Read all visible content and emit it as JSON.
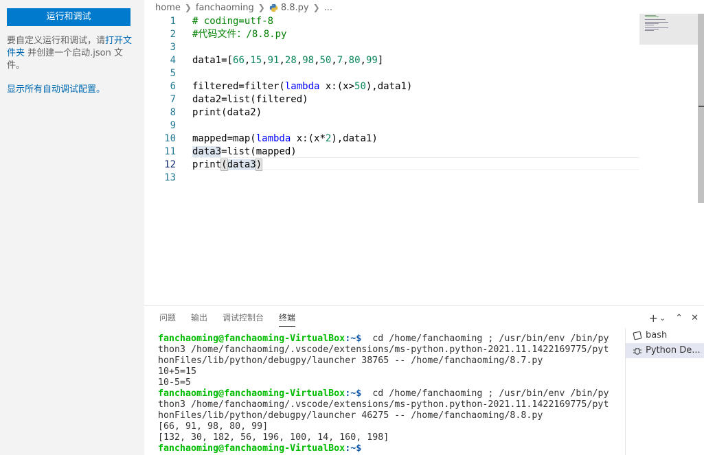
{
  "sidebar": {
    "run_button": "运行和调试",
    "text_pre": "要自定义运行和调试，请",
    "open_folder": "打开文件夹",
    "text_post": " 并创建一个启动.json 文件。",
    "show_all": "显示所有自动调试配置。"
  },
  "breadcrumb": [
    "home",
    "fanchaoming",
    "8.8.py",
    "..."
  ],
  "editor": {
    "line_numbers": [
      "1",
      "2",
      "3",
      "4",
      "5",
      "6",
      "7",
      "8",
      "9",
      "10",
      "11",
      "12",
      "13"
    ],
    "active_line": "12",
    "lines": {
      "l1": "# coding=utf-8",
      "l2": "#代码文件：/8.8.py",
      "l4_a": "data1=[",
      "l4_n": [
        "66",
        "15",
        "91",
        "28",
        "98",
        "50",
        "7",
        "80",
        "99"
      ],
      "l4_b": "]",
      "l6_a": "filtered=filter(",
      "l6_kw": "lambda",
      "l6_b": " x:(x>",
      "l6_n": "50",
      "l6_c": "),data1)",
      "l7": "data2=list(filtered)",
      "l8": "print(data2)",
      "l10_a": "mapped=map(",
      "l10_kw": "lambda",
      "l10_b": " x:(x*",
      "l10_n": "2",
      "l10_c": "),data1)",
      "l11_a": "data3",
      "l11_b": "=list(mapped)",
      "l12_a": "print",
      "l12_b": "(",
      "l12_c": "data3",
      "l12_d": ")"
    }
  },
  "panel": {
    "tabs": [
      "问题",
      "输出",
      "调试控制台",
      "终端"
    ],
    "active_tab": "终端",
    "actions": [
      "+",
      "⌄",
      "⌃",
      "✕"
    ],
    "terminal_lines": [
      {
        "user": "fanchaoming@fanchaoming-VirtualBox",
        "path": ":~$",
        "text": "  cd /home/fanchaoming ; /usr/bin/env /bin/py"
      },
      {
        "text": "thon3 /home/fanchaoming/.vscode/extensions/ms-python.python-2021.11.1422169775/pyt"
      },
      {
        "text": "honFiles/lib/python/debugpy/launcher 38765 -- /home/fanchaoming/8.7.py"
      },
      {
        "text": "10+5=15"
      },
      {
        "text": "10-5=5"
      },
      {
        "user": "fanchaoming@fanchaoming-VirtualBox",
        "path": ":~$",
        "text": "  cd /home/fanchaoming ; /usr/bin/env /bin/py"
      },
      {
        "text": "thon3 /home/fanchaoming/.vscode/extensions/ms-python.python-2021.11.1422169775/pyt"
      },
      {
        "text": "honFiles/lib/python/debugpy/launcher 46275 -- /home/fanchaoming/8.8.py"
      },
      {
        "text": "[66, 91, 98, 80, 99]"
      },
      {
        "text": "[132, 30, 182, 56, 196, 100, 14, 160, 198]"
      },
      {
        "user": "fanchaoming@fanchaoming-VirtualBox",
        "path": ":~$",
        "text": ""
      }
    ],
    "terminals": [
      "bash",
      "Python De..."
    ]
  },
  "colors": {
    "accent": "#007acc",
    "link": "#006ab1",
    "comment": "#008000",
    "keyword": "#0000ff",
    "number": "#098658",
    "prompt_user": "#00bc00",
    "prompt_path": "#0451a5"
  }
}
